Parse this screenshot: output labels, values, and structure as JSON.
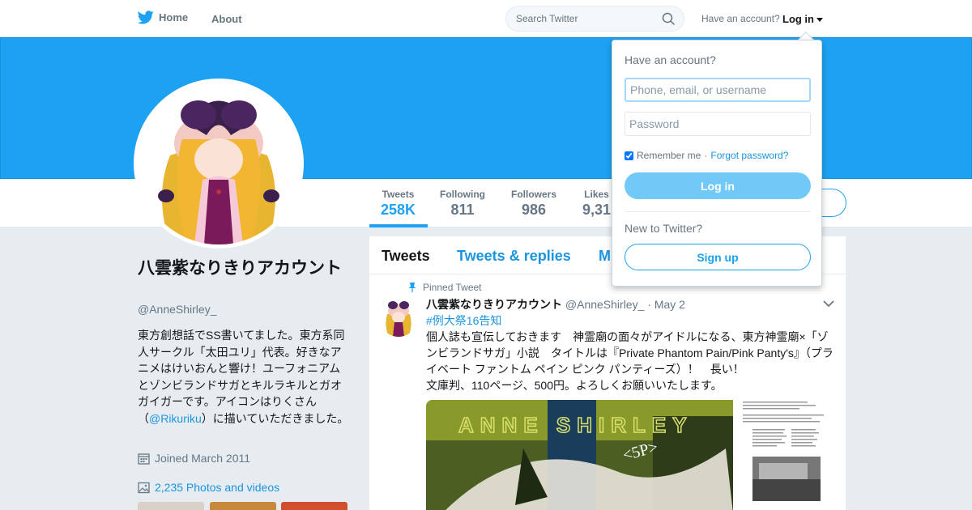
{
  "nav": {
    "home_label": "Home",
    "about_label": "About",
    "search_placeholder": "Search Twitter",
    "have_account_text": "Have an account?",
    "login_label": "Log in"
  },
  "stats": [
    {
      "label": "Tweets",
      "value": "258K"
    },
    {
      "label": "Following",
      "value": "811"
    },
    {
      "label": "Followers",
      "value": "986"
    },
    {
      "label": "Likes",
      "value": "9,31"
    }
  ],
  "profile": {
    "name": "八雲紫なりきりアカウント",
    "handle": "@AnneShirley_",
    "bio_before": "東方創想話でSS書いてました。東方系同人サークル「太田ユリ」代表。好きなアニメはけいおんと響け！ユーフォニアムとゾンビランドサガとキルラキルとガオガイガーです。アイコンはりくさん（",
    "bio_mention": "@Rikuriku",
    "bio_after": "）に描いていただきました。",
    "joined": "Joined March 2011",
    "photos": "2,235 Photos and videos"
  },
  "timeline": {
    "tabs": [
      "Tweets",
      "Tweets & replies",
      "M"
    ]
  },
  "tweet": {
    "pinned_label": "Pinned Tweet",
    "author_name": "八雲紫なりきりアカウント",
    "author_handle": "@AnneShirley_",
    "date": "· May 2",
    "hashtag": "#例大祭16告知",
    "text_line1": "個人誌も宣伝しておきます　神霊廟の面々がアイドルになる、東方神霊廟×「ゾンビランドサガ」小説　タイトルは『Private Phantom Pain/Pink Panty's』（プライベート ファントム ペイン ピンク パンティーズ）！　長い！",
    "text_line2": "文庫判、110ページ、500円。よろしくお願いいたします。"
  },
  "login_dropdown": {
    "title": "Have an account?",
    "username_placeholder": "Phone, email, or username",
    "password_placeholder": "Password",
    "remember_label": "Remember me",
    "separator": " · ",
    "forgot_label": "Forgot password?",
    "login_button": "Log in",
    "new_text": "New to Twitter?",
    "signup_button": "Sign up"
  },
  "colors": {
    "brand": "#1da1f2",
    "link": "#1b95e0",
    "banner": "#1da1f2"
  }
}
